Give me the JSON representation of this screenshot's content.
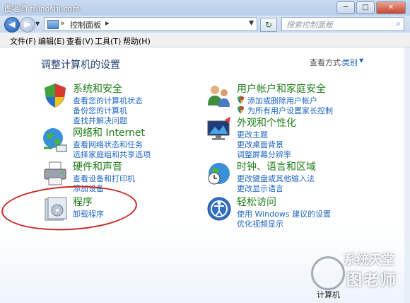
{
  "watermark": "图老师 tulaoshi.com",
  "window_buttons": {
    "minimize": "─",
    "maximize": "□",
    "close": "✕"
  },
  "nav": {
    "back_glyph": "◀",
    "forward_glyph": "▶",
    "breadcrumb_sep": "»",
    "address": "控制面板",
    "address_sep_after": "▸",
    "refresh_glyph": "↻",
    "search_placeholder": "搜索控制面板"
  },
  "menu": [
    "文件(F)",
    "编辑(E)",
    "查看(V)",
    "工具(T)",
    "帮助(H)"
  ],
  "content": {
    "title": "调整计算机的设置",
    "view_by_label": "查看方式:",
    "view_by_value": "类别"
  },
  "categories": [
    {
      "id": "system-security",
      "title": "系统和安全",
      "icon": "shield-icon",
      "links": [
        "查看您的计算机状态",
        "备份您的计算机",
        "查找并解决问题"
      ]
    },
    {
      "id": "network-internet",
      "title": "网络和 Internet",
      "icon": "network-globe-icon",
      "links": [
        "查看网络状态和任务",
        "选择家庭组和共享选项"
      ]
    },
    {
      "id": "hardware-sound",
      "title": "硬件和声音",
      "icon": "printer-icon",
      "links": [
        "查看设备和打印机",
        "添加设备"
      ]
    },
    {
      "id": "programs",
      "title": "程序",
      "icon": "programs-icon",
      "links": [
        "卸载程序"
      ]
    },
    {
      "id": "user-accounts",
      "title": "用户帐户和家庭安全",
      "icon": "users-icon",
      "links": [
        "添加或删除用户帐户",
        "为所有用户设置家长控制"
      ]
    },
    {
      "id": "appearance",
      "title": "外观和个性化",
      "icon": "monitor-icon",
      "links": [
        "更改主题",
        "更改桌面背景",
        "调整屏幕分辨率"
      ]
    },
    {
      "id": "clock-region",
      "title": "时钟、语言和区域",
      "icon": "clock-globe-icon",
      "links": [
        "更改键盘或其他输入法",
        "更改显示语言"
      ]
    },
    {
      "id": "ease-access",
      "title": "轻松访问",
      "icon": "ease-of-access-icon",
      "links": [
        "使用 Windows 建议的设置",
        "优化视频显示"
      ]
    }
  ],
  "bottom_watermark": {
    "line1": "系统天堂",
    "line2": "图老师"
  },
  "taskbar_item": "计算机",
  "colors": {
    "category_title": "#1e7b16",
    "link": "#1f66c1",
    "highlight_oval": "#c8261f"
  }
}
